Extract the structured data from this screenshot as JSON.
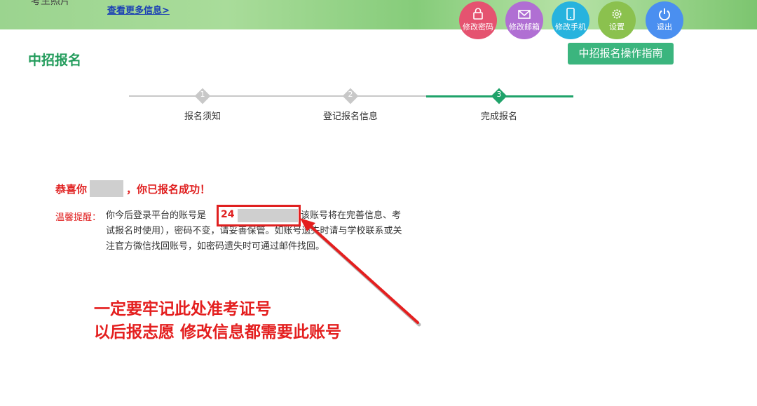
{
  "header": {
    "band_text": "考生照片",
    "more_link": "查看更多信息>",
    "actions": [
      {
        "label": "修改密码",
        "icon": "lock-icon",
        "color": "#e55370"
      },
      {
        "label": "修改邮箱",
        "icon": "mail-icon",
        "color": "#b06fd3"
      },
      {
        "label": "修改手机",
        "icon": "phone-icon",
        "color": "#27b3de"
      },
      {
        "label": "设置",
        "icon": "gear-icon",
        "color": "#8bc14e"
      },
      {
        "label": "退出",
        "icon": "power-icon",
        "color": "#4a8ff0"
      }
    ]
  },
  "page": {
    "title": "中招报名",
    "guide_button": "中招报名操作指南"
  },
  "steps": [
    {
      "number": "1",
      "label": "报名须知",
      "state": "done"
    },
    {
      "number": "2",
      "label": "登记报名信息",
      "state": "done"
    },
    {
      "number": "3",
      "label": "完成报名",
      "state": "active"
    }
  ],
  "result": {
    "congrats_prefix": "恭喜你",
    "congrats_suffix": "，你已报名成功！",
    "tip_label": "温馨提醒：",
    "tip_before_account": "你今后登录平台的账号是",
    "account_visible": "24",
    "tip_after_account": "（该账号将在完善信息、考试报名时使用），密码不变，请妥善保管。如账号遗失时请与学校联系或关注官方微信找回账号，如密码遗失时可通过邮件找回。"
  },
  "annotation": {
    "line1": "一定要牢记此处准考证号",
    "line2": "以后报志愿 修改信息都需要此账号"
  },
  "colors": {
    "brand_green": "#239c5c",
    "button_green": "#3bb57e",
    "alert_red": "#e02020",
    "step_inactive": "#c8c8c8",
    "step_active": "#1fa36a"
  }
}
